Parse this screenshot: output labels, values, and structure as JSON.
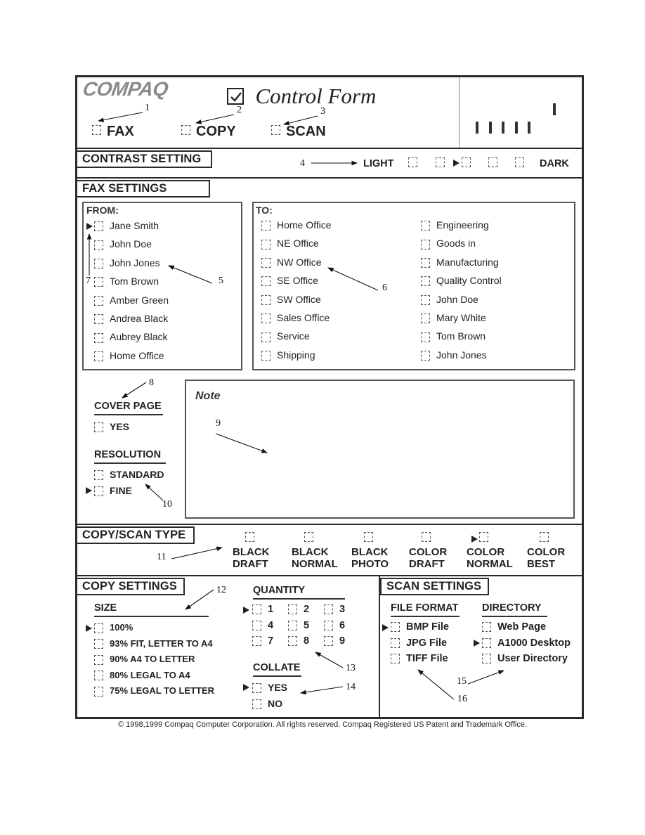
{
  "header": {
    "brand": "COMPAQ",
    "title": "Control Form",
    "modes": [
      {
        "label": "FAX",
        "callout": "1"
      },
      {
        "label": "COPY",
        "callout": "2"
      },
      {
        "label": "SCAN",
        "callout": "3"
      }
    ],
    "barcode_marks": [
      "|",
      "|",
      "|",
      "|",
      "|",
      "|"
    ]
  },
  "contrast": {
    "title": "CONTRAST SETTING",
    "callout": "4",
    "light_label": "LIGHT",
    "dark_label": "DARK",
    "levels": 5,
    "selected_level": 3
  },
  "fax": {
    "title": "FAX SETTINGS",
    "from": {
      "label": "FROM:",
      "selected": "Jane Smith",
      "items": [
        "Jane Smith",
        "John Doe",
        "John Jones",
        "Tom Brown",
        "Amber Green",
        "Andrea Black",
        "Aubrey Black",
        "Home Office"
      ],
      "callout_list": "5",
      "callout_selector": "7"
    },
    "to": {
      "label": "TO:",
      "col1": [
        "Home Office",
        "NE Office",
        "NW Office",
        "SE Office",
        "SW Office",
        "Sales Office",
        "Service",
        "Shipping"
      ],
      "col2": [
        "Engineering",
        "Goods in",
        "Manufacturing",
        "Quality Control",
        "John Doe",
        "Mary White",
        "Tom Brown",
        "John Jones"
      ],
      "callout": "6"
    },
    "cover_page": {
      "title": "COVER PAGE",
      "option": "YES",
      "callout": "8"
    },
    "resolution": {
      "title": "RESOLUTION",
      "options": [
        "STANDARD",
        "FINE"
      ],
      "selected": "FINE",
      "callout": "10"
    },
    "note": {
      "label": "Note",
      "callout": "9"
    }
  },
  "copy_scan_type": {
    "title": "COPY/SCAN TYPE",
    "callout": "11",
    "selected": "COLOR NORMAL",
    "options": [
      {
        "line1": "BLACK",
        "line2": "DRAFT"
      },
      {
        "line1": "BLACK",
        "line2": "NORMAL"
      },
      {
        "line1": "BLACK",
        "line2": "PHOTO"
      },
      {
        "line1": "COLOR",
        "line2": "DRAFT"
      },
      {
        "line1": "COLOR",
        "line2": "NORMAL"
      },
      {
        "line1": "COLOR",
        "line2": "BEST"
      }
    ]
  },
  "copy_settings": {
    "title": "COPY SETTINGS",
    "size": {
      "title": "SIZE",
      "callout": "12",
      "selected": "100%",
      "options": [
        "100%",
        "93% FIT, LETTER TO A4",
        "90% A4 TO LETTER",
        "80% LEGAL TO A4",
        "75% LEGAL TO LETTER"
      ]
    },
    "quantity": {
      "title": "QUANTITY",
      "callout": "13",
      "selected": "1",
      "options": [
        "1",
        "2",
        "3",
        "4",
        "5",
        "6",
        "7",
        "8",
        "9"
      ]
    },
    "collate": {
      "title": "COLLATE",
      "callout": "14",
      "selected": "YES",
      "options": [
        "YES",
        "NO"
      ]
    }
  },
  "scan_settings": {
    "title": "SCAN SETTINGS",
    "file_format": {
      "title": "FILE FORMAT",
      "callout": "16",
      "selected": "BMP File",
      "options": [
        "BMP File",
        "JPG File",
        "TIFF File"
      ]
    },
    "directory": {
      "title": "DIRECTORY",
      "callout": "15",
      "selected": "A1000 Desktop",
      "options": [
        "Web Page",
        "A1000 Desktop",
        "User Directory"
      ]
    }
  },
  "footer": {
    "copyright": "© 1998,1999 Compaq Computer Corporation.  All rights reserved.  Compaq Registered US Patent and Trademark Office."
  }
}
